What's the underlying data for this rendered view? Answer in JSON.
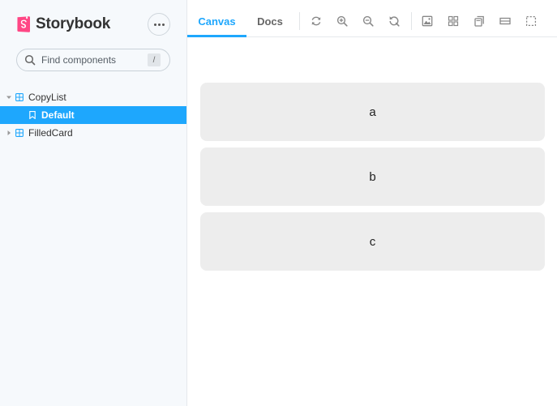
{
  "sidebar": {
    "brand": "Storybook",
    "search": {
      "placeholder": "Find components",
      "shortcut": "/"
    },
    "tree": [
      {
        "label": "CopyList",
        "type": "component",
        "expanded": true
      },
      {
        "label": "Default",
        "type": "story",
        "selected": true
      },
      {
        "label": "FilledCard",
        "type": "component",
        "expanded": false
      }
    ]
  },
  "toolbar": {
    "tabs": [
      {
        "label": "Canvas",
        "active": true
      },
      {
        "label": "Docs",
        "active": false
      }
    ],
    "tools": [
      "reload-icon",
      "zoom-in-icon",
      "zoom-out-icon",
      "zoom-reset-icon",
      "background-icon",
      "grid-icon",
      "viewport-icon",
      "measure-icon",
      "outline-icon"
    ]
  },
  "canvas": {
    "cards": [
      "a",
      "b",
      "c"
    ]
  },
  "colors": {
    "accent": "#1ea7fd",
    "brand": "#ff4785",
    "card": "#ededed",
    "sidebar_bg": "#f6f9fc"
  }
}
